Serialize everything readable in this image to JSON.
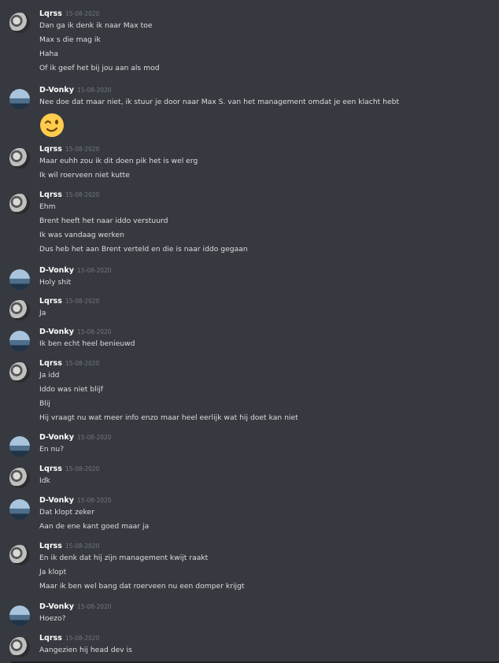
{
  "colors": {
    "background": "#36393f",
    "username": "#ffffff",
    "message": "#dcddde",
    "timestamp": "#72767d"
  },
  "groups": [
    {
      "user": "Lqrss",
      "avatar": "lqrss-avatar",
      "time": "15-08-2020",
      "lines": [
        "Dan ga ik denk ik naar Max toe",
        "Max s die mag ik",
        "Haha",
        "Of ik geef het bij jou aan als mod"
      ]
    },
    {
      "user": "D-Vonky",
      "avatar": "dvonky-avatar",
      "time": "15-08-2020",
      "lines": [
        "Nee doe dat maar niet, ik stuur je door naar Max S. van het management omdat je een klacht hebt"
      ],
      "emoji": "winking-face-emoji"
    },
    {
      "user": "Lqrss",
      "avatar": "lqrss-avatar",
      "time": "15-08-2020",
      "lines": [
        "Maar euhh zou ik dit doen pik het is wel erg",
        "Ik wil roerveen niet kutte"
      ]
    },
    {
      "user": "Lqrss",
      "avatar": "lqrss-avatar",
      "time": "15-08-2020",
      "lines": [
        "Ehm",
        "Brent heeft het naar iddo verstuurd",
        "Ik was vandaag werken",
        "Dus heb het aan Brent verteld en die is naar iddo gegaan"
      ]
    },
    {
      "user": "D-Vonky",
      "avatar": "dvonky-avatar",
      "time": "15-08-2020",
      "lines": [
        "Holy shit"
      ]
    },
    {
      "user": "Lqrss",
      "avatar": "lqrss-avatar",
      "time": "15-08-2020",
      "lines": [
        "Ja"
      ]
    },
    {
      "user": "D-Vonky",
      "avatar": "dvonky-avatar",
      "time": "15-08-2020",
      "lines": [
        "Ik ben echt heel benieuwd"
      ]
    },
    {
      "user": "Lqrss",
      "avatar": "lqrss-avatar",
      "time": "15-08-2020",
      "lines": [
        "Ja idd",
        "Iddo was niet blijf",
        "Blij",
        "Hij vraagt nu wat meer info enzo maar heel eerlijk wat hij doet kan niet"
      ]
    },
    {
      "user": "D-Vonky",
      "avatar": "dvonky-avatar",
      "time": "15-08-2020",
      "lines": [
        "En nu?"
      ]
    },
    {
      "user": "Lqrss",
      "avatar": "lqrss-avatar",
      "time": "15-08-2020",
      "lines": [
        "Idk"
      ]
    },
    {
      "user": "D-Vonky",
      "avatar": "dvonky-avatar",
      "time": "15-08-2020",
      "lines": [
        "Dat klopt zeker",
        "Aan de ene kant goed maar ja"
      ]
    },
    {
      "user": "Lqrss",
      "avatar": "lqrss-avatar",
      "time": "15-08-2020",
      "lines": [
        "En ik denk dat hij zijn management kwijt raakt",
        "Ja klopt",
        "Maar ik ben wel bang dat roerveen nu een domper krijgt"
      ]
    },
    {
      "user": "D-Vonky",
      "avatar": "dvonky-avatar",
      "time": "15-08-2020",
      "lines": [
        "Hoezo?"
      ]
    },
    {
      "user": "Lqrss",
      "avatar": "lqrss-avatar",
      "time": "15-08-2020",
      "lines": [
        "Aangezien hij head dev is"
      ]
    }
  ]
}
